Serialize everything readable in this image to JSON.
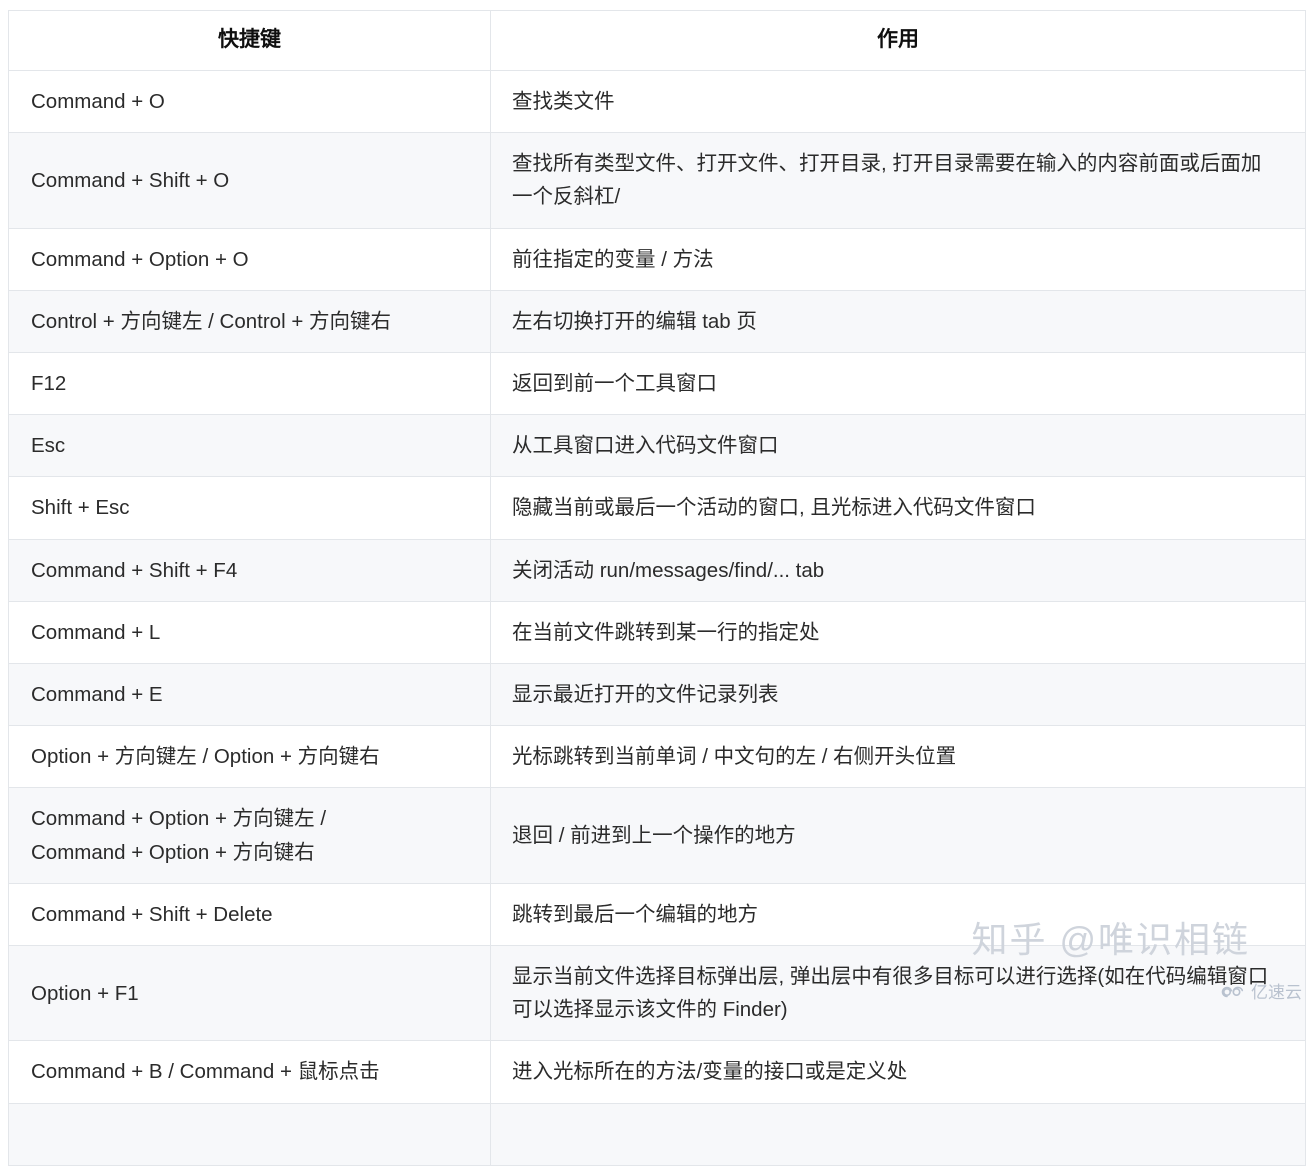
{
  "table": {
    "headers": [
      "快捷键",
      "作用"
    ],
    "rows": [
      {
        "key": [
          "Command + O"
        ],
        "desc": [
          "查找类文件"
        ]
      },
      {
        "key": [
          "Command + Shift + O"
        ],
        "desc": [
          "查找所有类型文件、打开文件、打开目录, 打开目录需要在输入的内容前面或后面加一个反斜杠/"
        ]
      },
      {
        "key": [
          "Command + Option + O"
        ],
        "desc": [
          "前往指定的变量 / 方法"
        ]
      },
      {
        "key": [
          "Control + 方向键左 / Control + 方向键右"
        ],
        "desc": [
          "左右切换打开的编辑 tab 页"
        ]
      },
      {
        "key": [
          "F12"
        ],
        "desc": [
          "返回到前一个工具窗口"
        ]
      },
      {
        "key": [
          "Esc"
        ],
        "desc": [
          "从工具窗口进入代码文件窗口"
        ]
      },
      {
        "key": [
          "Shift + Esc"
        ],
        "desc": [
          "隐藏当前或最后一个活动的窗口, 且光标进入代码文件窗口"
        ]
      },
      {
        "key": [
          "Command + Shift + F4"
        ],
        "desc": [
          "关闭活动 run/messages/find/... tab"
        ]
      },
      {
        "key": [
          "Command + L"
        ],
        "desc": [
          "在当前文件跳转到某一行的指定处"
        ]
      },
      {
        "key": [
          "Command + E"
        ],
        "desc": [
          "显示最近打开的文件记录列表"
        ]
      },
      {
        "key": [
          "Option + 方向键左 / Option + 方向键右"
        ],
        "desc": [
          "光标跳转到当前单词 / 中文句的左 / 右侧开头位置"
        ]
      },
      {
        "key": [
          "Command + Option + 方向键左 /",
          "Command + Option + 方向键右"
        ],
        "desc": [
          "退回 / 前进到上一个操作的地方"
        ]
      },
      {
        "key": [
          "Command + Shift + Delete"
        ],
        "desc": [
          "跳转到最后一个编辑的地方"
        ]
      },
      {
        "key": [
          "Option + F1"
        ],
        "desc": [
          "显示当前文件选择目标弹出层, 弹出层中有很多目标可以进行选择(如在代码编辑窗口可以选择显示该文件的 Finder)"
        ]
      },
      {
        "key": [
          "Command + B / Command + 鼠标点击"
        ],
        "desc": [
          "进入光标所在的方法/变量的接口或是定义处"
        ]
      }
    ]
  },
  "watermarks": {
    "zhihu_logo": "知乎",
    "zhihu_handle": "@唯识相链",
    "yisuyun_text": "亿速云"
  },
  "colors": {
    "stripe": "#f7f8fa",
    "border": "#e3e6ea",
    "text": "#2b2b2b",
    "watermark": "#cfd4dc"
  }
}
